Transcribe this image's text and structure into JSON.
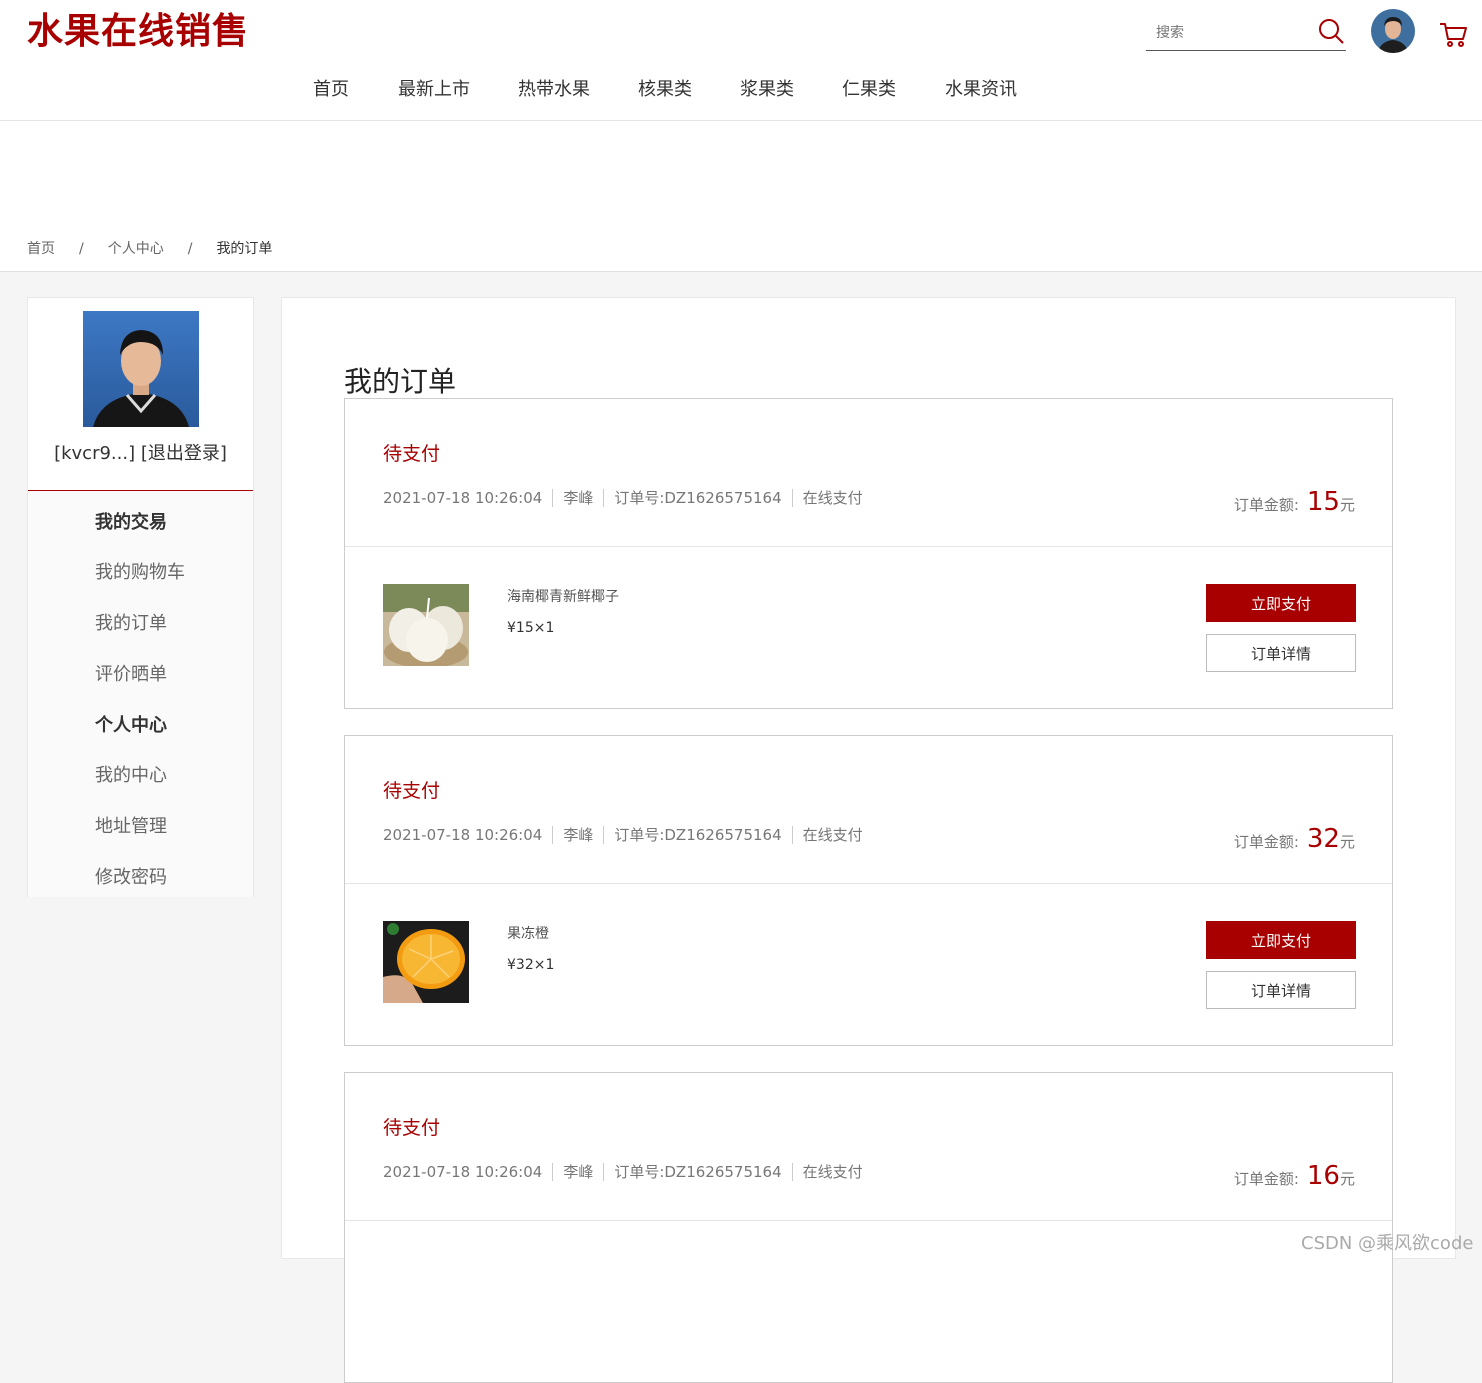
{
  "brand": {
    "logo": "水果在线销售"
  },
  "search": {
    "placeholder": "搜索"
  },
  "nav": [
    "首页",
    "最新上市",
    "热带水果",
    "核果类",
    "浆果类",
    "仁果类",
    "水果资讯"
  ],
  "breadcrumb": {
    "home": "首页",
    "sep": "/",
    "center": "个人中心",
    "current": "我的订单"
  },
  "sidebar": {
    "user": "[kvcr9...]",
    "logout": "[退出登录]",
    "sections": [
      {
        "title": "我的交易",
        "items": [
          "我的购物车",
          "我的订单",
          "评价晒单"
        ]
      },
      {
        "title": "个人中心",
        "items": [
          "我的中心",
          "地址管理",
          "修改密码"
        ]
      }
    ]
  },
  "main": {
    "title": "我的订单"
  },
  "orders": [
    {
      "status": "待支付",
      "time": "2021-07-18 10:26:04",
      "name": "李峰",
      "order_no": "订单号:DZ1626575164",
      "pay_type": "在线支付",
      "amount_label": "订单金额:",
      "amount": "15",
      "unit": "元",
      "product": "海南椰青新鲜椰子",
      "price": "¥15×1",
      "pay_btn": "立即支付",
      "detail_btn": "订单详情",
      "thumb": "coconut"
    },
    {
      "status": "待支付",
      "time": "2021-07-18 10:26:04",
      "name": "李峰",
      "order_no": "订单号:DZ1626575164",
      "pay_type": "在线支付",
      "amount_label": "订单金额:",
      "amount": "32",
      "unit": "元",
      "product": "果冻橙",
      "price": "¥32×1",
      "pay_btn": "立即支付",
      "detail_btn": "订单详情",
      "thumb": "orange"
    },
    {
      "status": "待支付",
      "time": "2021-07-18 10:26:04",
      "name": "李峰",
      "order_no": "订单号:DZ1626575164",
      "pay_type": "在线支付",
      "amount_label": "订单金额:",
      "amount": "16",
      "unit": "元"
    }
  ],
  "watermark": "CSDN @乘风欲code",
  "colors": {
    "accent": "#a80000"
  }
}
